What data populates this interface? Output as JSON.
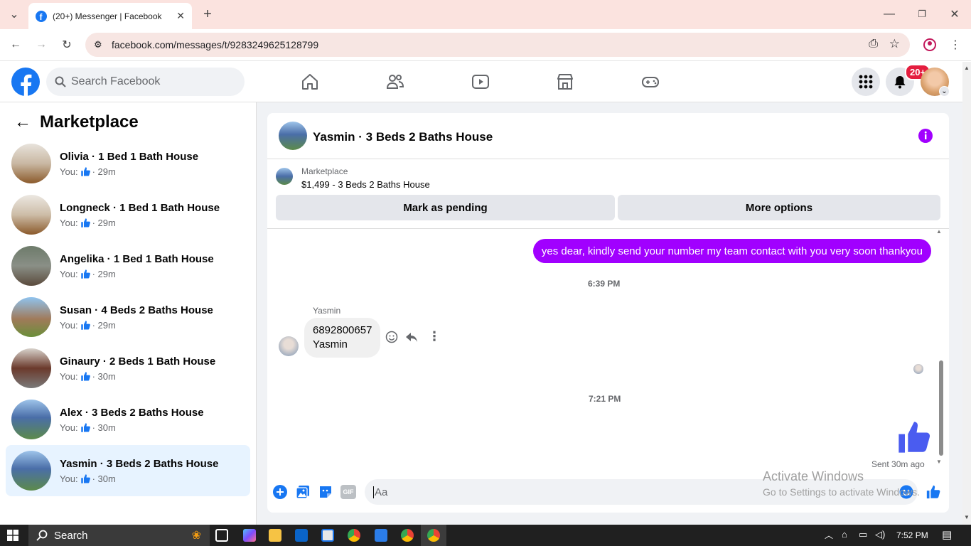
{
  "browser": {
    "tab_title": "(20+) Messenger | Facebook",
    "url": "facebook.com/messages/t/9283249625128799"
  },
  "fb": {
    "search_placeholder": "Search Facebook",
    "notif_badge": "20+"
  },
  "sidebar": {
    "title": "Marketplace",
    "conversations": [
      {
        "name": "Olivia · 1 Bed 1 Bath House",
        "you": "You:",
        "time": "· 29m"
      },
      {
        "name": "Longneck · 1 Bed 1 Bath House",
        "you": "You:",
        "time": "· 29m"
      },
      {
        "name": "Angelika · 1 Bed 1 Bath House",
        "you": "You:",
        "time": "· 29m"
      },
      {
        "name": "Susan · 4 Beds 2 Baths House",
        "you": "You:",
        "time": "· 29m"
      },
      {
        "name": "Ginaury · 2 Beds 1 Bath House",
        "you": "You:",
        "time": "· 30m"
      },
      {
        "name": "Alex · 3 Beds 2 Baths House",
        "you": "You:",
        "time": "· 30m"
      },
      {
        "name": "Yasmin · 3 Beds 2 Baths House",
        "you": "You:",
        "time": "· 30m"
      }
    ]
  },
  "chat": {
    "title": "Yasmin · 3 Beds 2 Baths House",
    "listing_source": "Marketplace",
    "listing_title": "$1,499 - 3 Beds 2 Baths House",
    "pending_button": "Mark as pending",
    "more_button": "More options",
    "outgoing_message": "yes dear, kindly send your number my team contact with you very soon thankyou",
    "timestamp1": "6:39 PM",
    "sender_name": "Yasmin",
    "incoming_line1": "6892800657",
    "incoming_line2": "Yasmin",
    "timestamp2": "7:21 PM",
    "sent_status": "Sent 30m ago",
    "input_placeholder": "Aa"
  },
  "watermark": {
    "line1": "Activate Windows",
    "line2": "Go to Settings to activate Windows."
  },
  "taskbar": {
    "search_label": "Search",
    "time": "7:52 PM"
  },
  "colors": {
    "fb_blue": "#1877f2",
    "accent_purple": "#a100ff",
    "notif_red": "#e41e3f"
  }
}
